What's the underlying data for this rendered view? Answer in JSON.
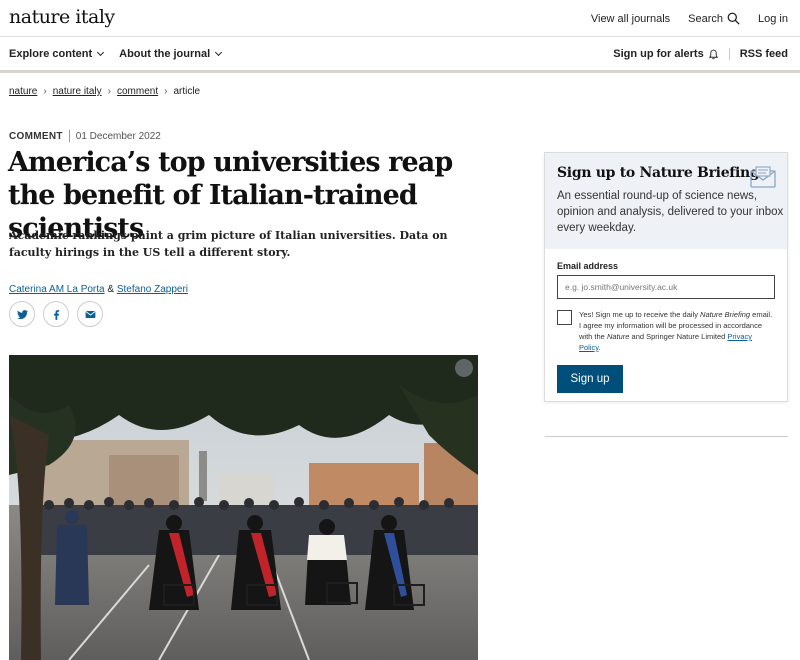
{
  "header": {
    "logo": "nature italy",
    "links": {
      "journals": "View all journals",
      "search": "Search",
      "login": "Log in"
    }
  },
  "nav": {
    "explore": "Explore content",
    "about": "About the journal",
    "alerts": "Sign up for alerts",
    "rss": "RSS feed"
  },
  "breadcrumb": [
    "nature",
    "nature italy",
    "comment",
    "article"
  ],
  "article": {
    "type": "COMMENT",
    "date": "01 December 2022",
    "title": "America’s top universities reap the benefit of Italian-trained scientists",
    "standfirst": "Academic rankings paint a grim picture of Italian universities. Data on faculty hirings in the US tell a different story.",
    "author1": "Caterina AM La Porta",
    "author_sep": "&",
    "author2": "Stefano Zapperi"
  },
  "share": {
    "icons": [
      "twitter-icon",
      "facebook-icon",
      "email-icon"
    ]
  },
  "briefing": {
    "title": "Sign up to Nature Briefing",
    "description": "An essential round-up of science news, opinion and analysis, delivered to your inbox every weekday.",
    "email_label": "Email address",
    "email_placeholder": "e.g. jo.smith@university.ac.uk",
    "consent_1": "Yes! Sign me up to receive the daily ",
    "consent_em1": "Nature Briefing",
    "consent_2": " email. I agree my information will be processed in accordance with the ",
    "consent_em2": "Nature",
    "consent_3": " and Springer Nature Limited ",
    "privacy_link": "Privacy Policy",
    "consent_4": ".",
    "signup": "Sign up"
  },
  "colors": {
    "accent": "#004f7a",
    "link": "#0a5f94",
    "briefing_bg": "#eef1f6"
  }
}
